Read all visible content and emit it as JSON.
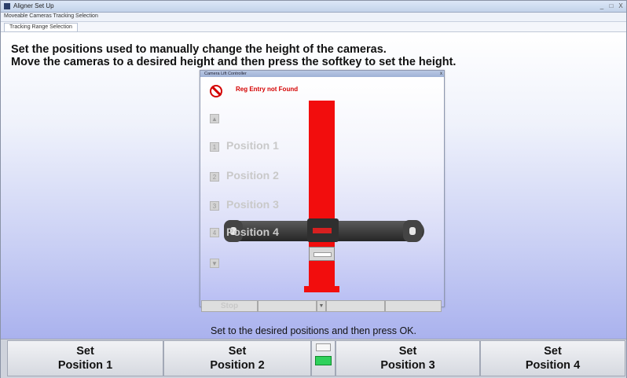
{
  "window": {
    "title": "Aligner Set Up",
    "controls": [
      "_",
      "□",
      "X"
    ]
  },
  "menu": {
    "label": "Moveable Cameras Tracking Selection"
  },
  "tab": {
    "label": "Tracking Range Selection"
  },
  "instructions": {
    "line1": "Set the positions used to manually change the height of the cameras.",
    "line2": "Move the cameras to a desired height and then press the softkey to set the height."
  },
  "dialog": {
    "title": "Camera Lift Controller",
    "close": "x",
    "error": "Reg Entry not Found",
    "positions": [
      {
        "key": "1",
        "label": "Position 1"
      },
      {
        "key": "2",
        "label": "Position 2"
      },
      {
        "key": "3",
        "label": "Position 3"
      },
      {
        "key": "4",
        "label": "Position 4"
      }
    ],
    "buttons": {
      "stop": "Stop"
    }
  },
  "footer_text": "Set to the desired positions and then press OK.",
  "bottom_buttons": [
    {
      "line1": "Set",
      "line2": "Position 1"
    },
    {
      "line1": "Set",
      "line2": "Position 2"
    },
    {
      "line1": "Set",
      "line2": "Position 3"
    },
    {
      "line1": "Set",
      "line2": "Position 4"
    }
  ],
  "colors": {
    "error": "#d40000",
    "pole": "#f20d0d",
    "indicator": "#2fd15c"
  }
}
